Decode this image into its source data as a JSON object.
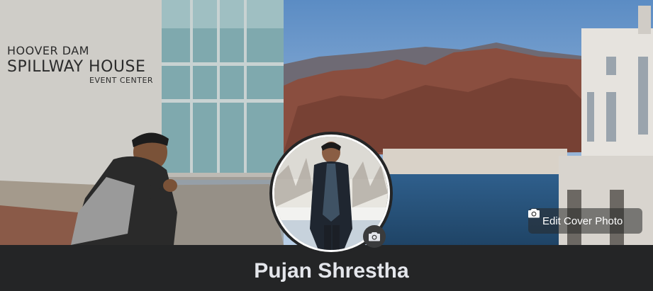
{
  "cover": {
    "building_sign": {
      "line1": "HOOVER DAM",
      "line2": "SPILLWAY HOUSE",
      "line3": "EVENT CENTER"
    },
    "edit_cover_label": "Edit Cover Photo",
    "edit_cover_icon": "camera-icon"
  },
  "profile": {
    "name": "Pujan Shrestha",
    "avatar_camera_icon": "camera-icon"
  },
  "colors": {
    "page_background": "#242526",
    "name_text": "#e4e6eb",
    "button_text": "#ffffff"
  }
}
